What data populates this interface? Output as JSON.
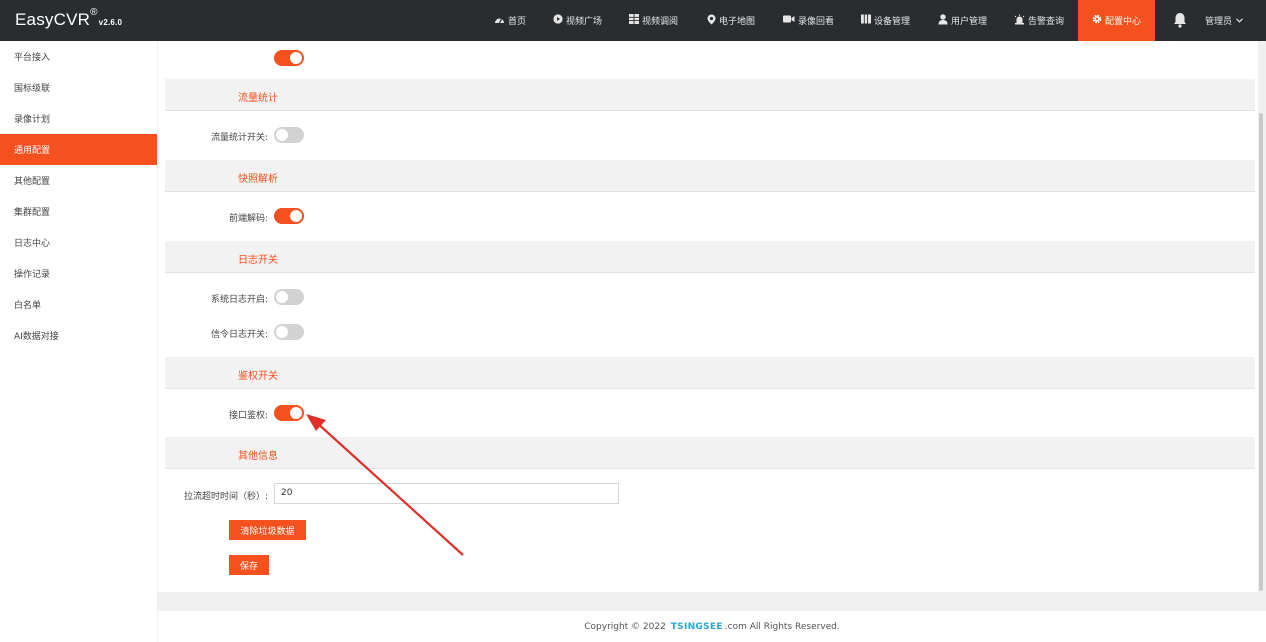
{
  "app": {
    "name": "EasyCVR",
    "reg_mark": "®",
    "version": "v2.6.0"
  },
  "nav": [
    {
      "label": "首页",
      "icon": "dashboard-icon"
    },
    {
      "label": "视频广场",
      "icon": "play-circle-icon"
    },
    {
      "label": "视频调阅",
      "icon": "grid-icon"
    },
    {
      "label": "电子地图",
      "icon": "map-pin-icon"
    },
    {
      "label": "录像回看",
      "icon": "video-camera-icon"
    },
    {
      "label": "设备管理",
      "icon": "device-icon"
    },
    {
      "label": "用户管理",
      "icon": "user-icon"
    },
    {
      "label": "告警查询",
      "icon": "alarm-icon"
    },
    {
      "label": "配置中心",
      "icon": "gear-icon",
      "active": true
    }
  ],
  "user": {
    "label": "管理员"
  },
  "sidebar": {
    "items": [
      {
        "label": "平台接入"
      },
      {
        "label": "国标级联"
      },
      {
        "label": "录像计划"
      },
      {
        "label": "通用配置",
        "active": true
      },
      {
        "label": "其他配置"
      },
      {
        "label": "集群配置"
      },
      {
        "label": "日志中心"
      },
      {
        "label": "操作记录"
      },
      {
        "label": "白名单"
      },
      {
        "label": "AI数据对接"
      }
    ]
  },
  "sections": {
    "traffic": {
      "title": "流量统计",
      "toggle_label": "流量统计开关:",
      "toggle_on": false
    },
    "snapshot": {
      "title": "快照解析",
      "toggle_label": "前端解码:",
      "toggle_on": true
    },
    "log": {
      "title": "日志开关",
      "sys_label": "系统日志开启:",
      "sys_on": false,
      "signal_label": "信令日志开关:",
      "signal_on": false
    },
    "auth": {
      "title": "鉴权开关",
      "toggle_label": "接口鉴权:",
      "toggle_on": true
    },
    "other": {
      "title": "其他信息",
      "timeout_label": "拉流超时时间（秒）:",
      "timeout_value": "20",
      "clear_button": "清除垃圾数据",
      "save_button": "保存"
    }
  },
  "footer": {
    "prefix": "Copyright © 2022",
    "brand": "TSINGSEE",
    "suffix": ".com All Rights Reserved."
  },
  "colors": {
    "accent": "#f4511e",
    "topbar": "#2a2d30",
    "arrow": "#e0302a"
  }
}
